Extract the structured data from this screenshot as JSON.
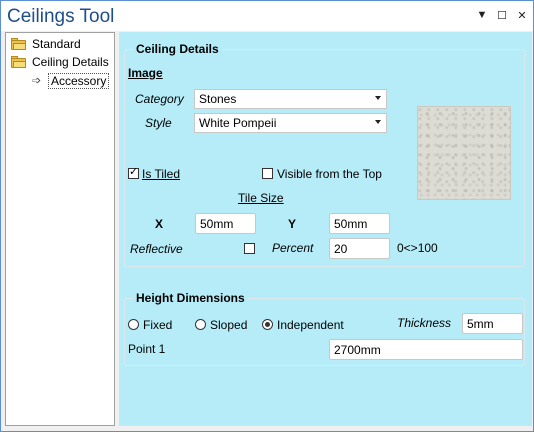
{
  "window": {
    "title": "Ceilings Tool"
  },
  "titlebar_buttons": {
    "menu": "▼",
    "maximize": "☐",
    "close": "✕"
  },
  "tree": {
    "items": [
      {
        "label": "Standard"
      },
      {
        "label": "Ceiling Details"
      },
      {
        "label": "Accessory"
      }
    ]
  },
  "ceiling_details": {
    "group_title": "Ceiling Details",
    "image_label": "Image",
    "category_label": "Category",
    "category_value": "Stones",
    "style_label": "Style",
    "style_value": "White Pompeii",
    "is_tiled_label": "Is Tiled",
    "is_tiled_checked": true,
    "visible_top_label": "Visible from the Top",
    "visible_top_checked": false,
    "tile_size_label": "Tile Size",
    "x_label": "X",
    "x_value": "50mm",
    "y_label": "Y",
    "y_value": "50mm",
    "reflective_label": "Reflective",
    "reflective_checked": false,
    "percent_label": "Percent",
    "percent_value": "20",
    "percent_range": "0<>100"
  },
  "height_dimensions": {
    "group_title": "Height Dimensions",
    "options": [
      "Fixed",
      "Sloped",
      "Independent"
    ],
    "selected": "Independent",
    "thickness_label": "Thickness",
    "thickness_value": "5mm",
    "point1_label": "Point 1",
    "point1_value": "2700mm"
  },
  "colors": {
    "panel_bg": "#b6ecf8",
    "title": "#1f4e8c",
    "window_border": "#5b8fd1"
  }
}
